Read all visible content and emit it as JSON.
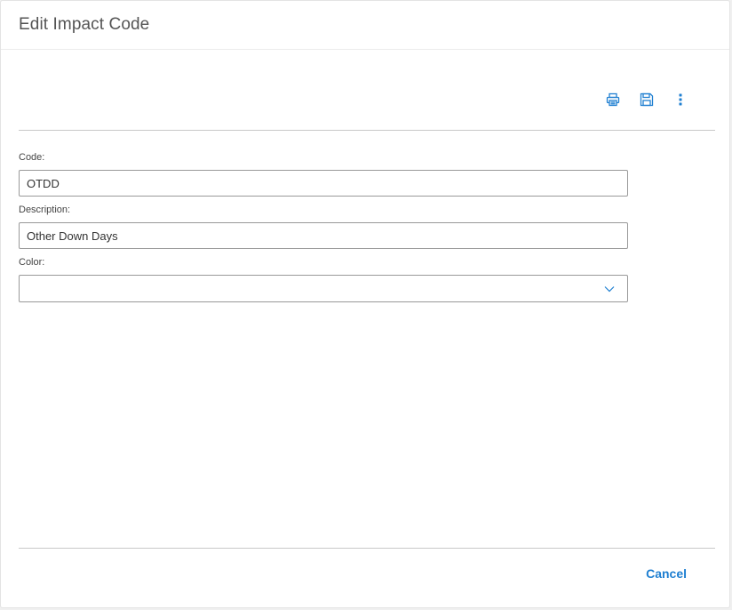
{
  "dialog": {
    "title": "Edit Impact Code"
  },
  "toolbar": {
    "icons": [
      "printer-icon",
      "save-icon",
      "more-vertical-icon"
    ],
    "accent_color": "#1f7fd1"
  },
  "form": {
    "code": {
      "label": "Code:",
      "value": "OTDD"
    },
    "description": {
      "label": "Description:",
      "value": "Other Down Days"
    },
    "color": {
      "label": "Color:",
      "value": ""
    }
  },
  "footer": {
    "cancel_label": "Cancel"
  }
}
